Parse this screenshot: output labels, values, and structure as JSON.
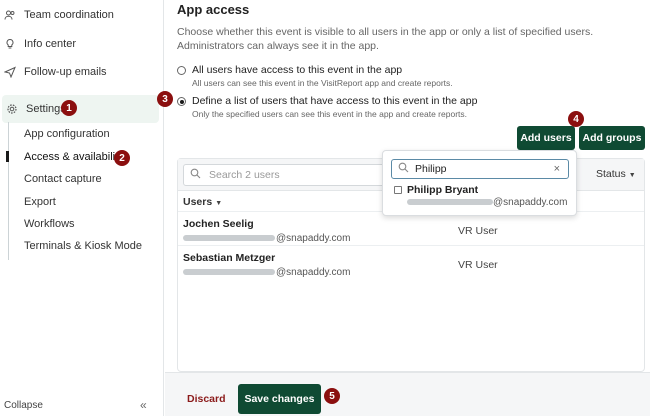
{
  "sidebar": {
    "items": [
      {
        "label": "Team coordination",
        "icon": "team-icon"
      },
      {
        "label": "Info center",
        "icon": "lightbulb-icon"
      },
      {
        "label": "Follow-up emails",
        "icon": "send-icon"
      },
      {
        "label": "Settings",
        "icon": "gear-icon"
      }
    ],
    "settings_sub": [
      "App configuration",
      "Access & availability",
      "Contact capture",
      "Export",
      "Workflows",
      "Terminals & Kiosk Mode"
    ],
    "collapse_label": "Collapse",
    "collapse_icon": "«"
  },
  "badges": [
    "1",
    "2",
    "3",
    "4",
    "5"
  ],
  "main": {
    "title": "App access",
    "description": "Choose whether this event is visible to all users in the app or only a list of specified users. Administrators can always see it in the app.",
    "options": [
      {
        "label": "All users have access to this event in the app",
        "hint": "All users can see this event in the VisitReport app and create reports.",
        "selected": false
      },
      {
        "label": "Define a list of users that have access to this event in the app",
        "hint": "Only the specified users can see this event in the app and create reports.",
        "selected": true
      }
    ],
    "add_users_label": "Add users",
    "add_groups_label": "Add groups"
  },
  "table": {
    "search_placeholder": "Search 2 users",
    "status_label": "Status",
    "users_column": "Users",
    "rows": [
      {
        "name": "Jochen Seelig",
        "email_domain": "@snapaddy.com",
        "role": "VR User"
      },
      {
        "name": "Sebastian Metzger",
        "email_domain": "@snapaddy.com",
        "role": "VR User"
      }
    ]
  },
  "popover": {
    "query": "Philipp",
    "clear_icon": "×",
    "result": {
      "name": "Philipp Bryant",
      "email_domain": "@snapaddy.com"
    }
  },
  "footer": {
    "discard_label": "Discard",
    "save_label": "Save changes"
  },
  "colors": {
    "primary": "#0f4a33",
    "badge": "#8b0f0f",
    "discard": "#8b1a1a"
  }
}
